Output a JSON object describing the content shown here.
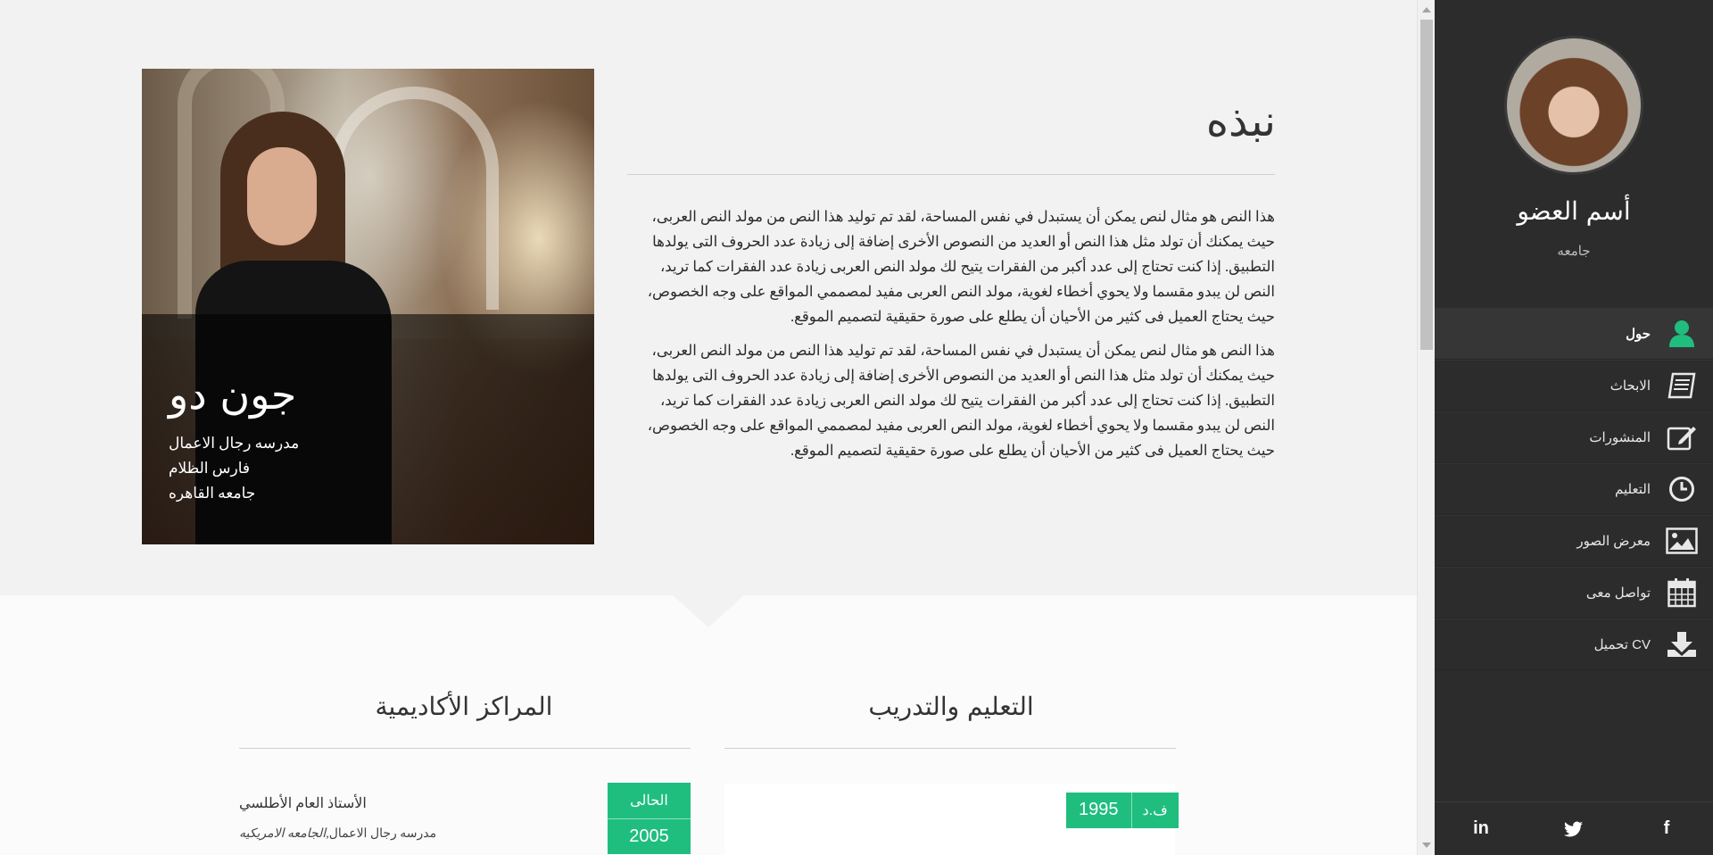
{
  "about": {
    "title": "نبذه",
    "paragraphs": [
      "هذا النص هو مثال لنص يمكن أن يستبدل في نفس المساحة، لقد تم توليد هذا النص من مولد النص العربى، حيث يمكنك أن تولد مثل هذا النص أو العديد من النصوص الأخرى إضافة إلى زيادة عدد الحروف التى يولدها التطبيق. إذا كنت تحتاج إلى عدد أكبر من الفقرات يتيح لك مولد النص العربى زيادة عدد الفقرات كما تريد، النص لن يبدو مقسما ولا يحوي أخطاء لغوية، مولد النص العربى مفيد لمصممي المواقع على وجه الخصوص، حيث يحتاج العميل فى كثير من الأحيان أن يطلع على صورة حقيقية لتصميم الموقع.",
      "هذا النص هو مثال لنص يمكن أن يستبدل في نفس المساحة، لقد تم توليد هذا النص من مولد النص العربى، حيث يمكنك أن تولد مثل هذا النص أو العديد من النصوص الأخرى إضافة إلى زيادة عدد الحروف التى يولدها التطبيق. إذا كنت تحتاج إلى عدد أكبر من الفقرات يتيح لك مولد النص العربى زيادة عدد الفقرات كما تريد، النص لن يبدو مقسما ولا يحوي أخطاء لغوية، مولد النص العربى مفيد لمصممي المواقع على وجه الخصوص، حيث يحتاج العميل فى كثير من الأحيان أن يطلع على صورة حقيقية لتصميم الموقع."
    ]
  },
  "profile_card": {
    "name": "جون دو",
    "lines": [
      "مدرسه رجال الاعمال",
      "فارس الظلام",
      "جامعه القاهره"
    ]
  },
  "education": {
    "title": "التعليم والتدريب",
    "item": {
      "degree": "ف.د",
      "year": "1995",
      "subtitle": "..."
    }
  },
  "academic": {
    "title": "المراكز الأكاديمية",
    "item": {
      "badge_label": "الحالى",
      "year": "2005",
      "role": "الأستاذ العام الأطلسي",
      "school_italic": "الجامعه الامريكيه",
      "school_rest": "مدرسه رجال الاعمال"
    }
  },
  "sidebar": {
    "member_name": "أسم العضو",
    "university": "جامعه",
    "nav": [
      {
        "label": "حول",
        "icon": "user-icon",
        "active": true
      },
      {
        "label": "الابحاث",
        "icon": "book-icon",
        "active": false
      },
      {
        "label": "المنشورات",
        "icon": "edit-icon",
        "active": false
      },
      {
        "label": "التعليم",
        "icon": "clock-icon",
        "active": false
      },
      {
        "label": "معرض الصور",
        "icon": "image-icon",
        "active": false
      },
      {
        "label": "تواصل معى",
        "icon": "calendar-icon",
        "active": false
      },
      {
        "label": "CV تحميل",
        "icon": "download-icon",
        "active": false
      }
    ],
    "social": [
      {
        "label": "in",
        "icon": "linkedin-icon"
      },
      {
        "label": "🐦",
        "icon": "twitter-icon"
      },
      {
        "label": "f",
        "icon": "facebook-icon"
      }
    ]
  },
  "colors": {
    "accent": "#1fbe7f",
    "sidebar_bg": "#2c2c2c",
    "content_bg": "#f2f2f2"
  }
}
